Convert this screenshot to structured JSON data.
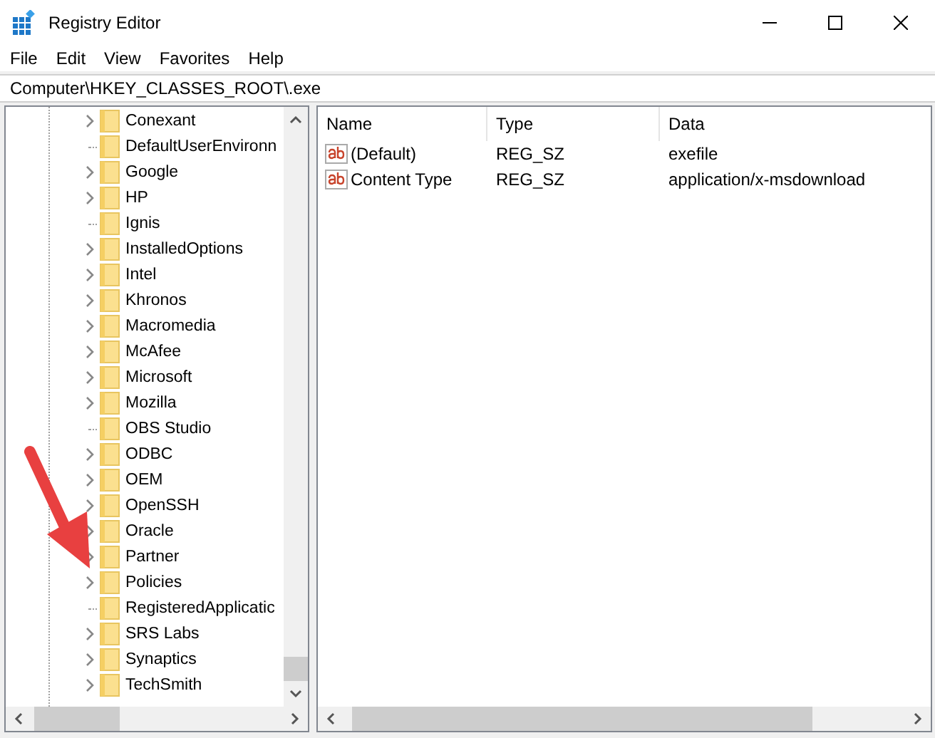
{
  "window": {
    "title": "Registry Editor"
  },
  "menu": [
    "File",
    "Edit",
    "View",
    "Favorites",
    "Help"
  ],
  "address": "Computer\\HKEY_CLASSES_ROOT\\.exe",
  "tree": [
    {
      "label": "Conexant",
      "kind": "expandable"
    },
    {
      "label": "DefaultUserEnvironn",
      "kind": "leaf"
    },
    {
      "label": "Google",
      "kind": "expandable"
    },
    {
      "label": "HP",
      "kind": "expandable"
    },
    {
      "label": "Ignis",
      "kind": "leaf"
    },
    {
      "label": "InstalledOptions",
      "kind": "expandable"
    },
    {
      "label": "Intel",
      "kind": "expandable"
    },
    {
      "label": "Khronos",
      "kind": "expandable"
    },
    {
      "label": "Macromedia",
      "kind": "expandable"
    },
    {
      "label": "McAfee",
      "kind": "expandable"
    },
    {
      "label": "Microsoft",
      "kind": "expandable"
    },
    {
      "label": "Mozilla",
      "kind": "expandable"
    },
    {
      "label": "OBS Studio",
      "kind": "leaf"
    },
    {
      "label": "ODBC",
      "kind": "expandable"
    },
    {
      "label": "OEM",
      "kind": "expandable"
    },
    {
      "label": "OpenSSH",
      "kind": "expandable"
    },
    {
      "label": "Oracle",
      "kind": "expandable"
    },
    {
      "label": "Partner",
      "kind": "expandable"
    },
    {
      "label": "Policies",
      "kind": "expandable"
    },
    {
      "label": "RegisteredApplicatic",
      "kind": "leaf"
    },
    {
      "label": "SRS Labs",
      "kind": "expandable"
    },
    {
      "label": "Synaptics",
      "kind": "expandable"
    },
    {
      "label": "TechSmith",
      "kind": "expandable"
    }
  ],
  "table": {
    "columns": [
      "Name",
      "Type",
      "Data"
    ],
    "rows": [
      [
        "(Default)",
        "REG_SZ",
        "exefile"
      ],
      [
        "Content Type",
        "REG_SZ",
        "application/x-msdownload"
      ]
    ]
  }
}
